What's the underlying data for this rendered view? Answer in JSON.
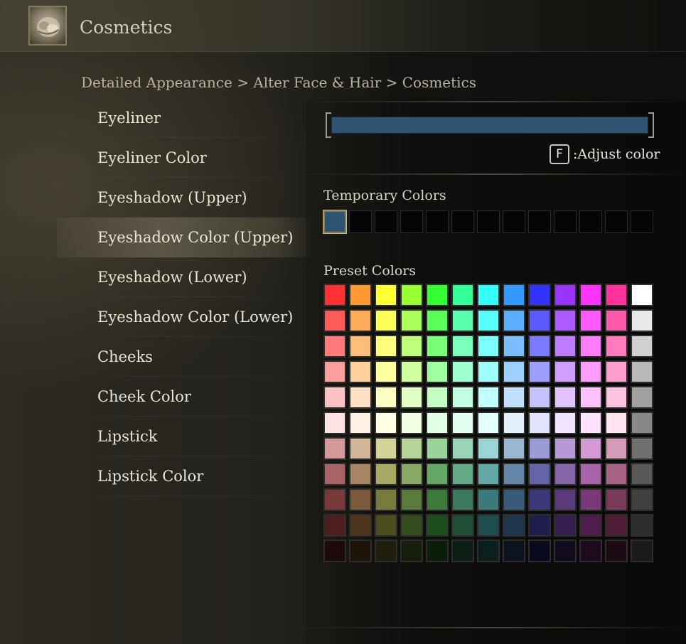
{
  "header": {
    "title": "Cosmetics",
    "icon": "face-makeup-icon"
  },
  "breadcrumb": "Detailed Appearance > Alter Face & Hair > Cosmetics",
  "menu": {
    "items": [
      {
        "label": "Eyeliner"
      },
      {
        "label": "Eyeliner Color"
      },
      {
        "label": "Eyeshadow (Upper)"
      },
      {
        "label": "Eyeshadow Color (Upper)",
        "selected": true
      },
      {
        "label": "Eyeshadow (Lower)"
      },
      {
        "label": "Eyeshadow Color (Lower)"
      },
      {
        "label": "Cheeks"
      },
      {
        "label": "Cheek Color"
      },
      {
        "label": "Lipstick"
      },
      {
        "label": "Lipstick Color"
      }
    ]
  },
  "color_panel": {
    "current_color": "#2f5471",
    "adjust_key": "F",
    "adjust_label": ":Adjust color",
    "temporary_label": "Temporary Colors",
    "temporary_colors": [
      "#2f5471",
      "#050505",
      "#050505",
      "#050505",
      "#050505",
      "#050505",
      "#050505",
      "#050505",
      "#050505",
      "#050505",
      "#050505",
      "#050505",
      "#050505"
    ],
    "preset_label": "Preset Colors",
    "preset_colors": [
      [
        "#ff3333",
        "#ff9933",
        "#ffff33",
        "#99ff33",
        "#33ff33",
        "#33ff99",
        "#33ffff",
        "#3399ff",
        "#3333ff",
        "#9933ff",
        "#ff33ff",
        "#ff3399",
        "#ffffff"
      ],
      [
        "#ff5a5a",
        "#ffad5a",
        "#ffff5a",
        "#adff5a",
        "#5aff5a",
        "#5affad",
        "#5affff",
        "#5aadff",
        "#5a5aff",
        "#ad5aff",
        "#ff5aff",
        "#ff5aad",
        "#e8e8e8"
      ],
      [
        "#ff7b7b",
        "#ffbd7b",
        "#ffff7b",
        "#bdff7b",
        "#7bff7b",
        "#7bffbd",
        "#7bffff",
        "#7bbdff",
        "#7b7bff",
        "#bd7bff",
        "#ff7bff",
        "#ff7bbd",
        "#d0d0d0"
      ],
      [
        "#ff9e9e",
        "#ffcf9e",
        "#ffff9e",
        "#cfff9e",
        "#9eff9e",
        "#9effcf",
        "#9effff",
        "#9ecfff",
        "#9e9eff",
        "#cf9eff",
        "#ff9eff",
        "#ff9ecf",
        "#b8b8b8"
      ],
      [
        "#ffc2c2",
        "#ffe0c2",
        "#ffffc2",
        "#e0ffc2",
        "#c2ffc2",
        "#c2ffe0",
        "#c2ffff",
        "#c2e0ff",
        "#c2c2ff",
        "#e0c2ff",
        "#ffc2ff",
        "#ffc2e0",
        "#a0a0a0"
      ],
      [
        "#ffe3e3",
        "#fff1e3",
        "#ffffe3",
        "#f1ffe3",
        "#e3ffe3",
        "#e3fff1",
        "#e3ffff",
        "#e3f1ff",
        "#e3e3ff",
        "#f1e3ff",
        "#ffe3ff",
        "#ffe3f1",
        "#888888"
      ],
      [
        "#d49a9a",
        "#d4b79a",
        "#d4d49a",
        "#b7d49a",
        "#9ad49a",
        "#9ad4b7",
        "#9ad4d4",
        "#9ab7d4",
        "#9a9ad4",
        "#b79ad4",
        "#d49ad4",
        "#d49ab7",
        "#707070"
      ],
      [
        "#a86464",
        "#a88664",
        "#a8a864",
        "#86a864",
        "#64a864",
        "#64a886",
        "#64a8a8",
        "#6486a8",
        "#6464a8",
        "#8664a8",
        "#a864a8",
        "#a86486",
        "#585858"
      ],
      [
        "#7a3a3a",
        "#7a5a3a",
        "#7a7a3a",
        "#5a7a3a",
        "#3a7a3a",
        "#3a7a5a",
        "#3a7a7a",
        "#3a5a7a",
        "#3a3a7a",
        "#5a3a7a",
        "#7a3a7a",
        "#7a3a5a",
        "#404040"
      ],
      [
        "#4d1e1e",
        "#4d351e",
        "#4d4d1e",
        "#354d1e",
        "#1e4d1e",
        "#1e4d35",
        "#1e4d4d",
        "#1e354d",
        "#1e1e4d",
        "#351e4d",
        "#4d1e4d",
        "#4d1e35",
        "#2e2e2e"
      ],
      [
        "#1e0a0a",
        "#1e140a",
        "#1e1e0a",
        "#141e0a",
        "#0a1e0a",
        "#0a1e14",
        "#0a1e1e",
        "#0a141e",
        "#0a0a1e",
        "#140a1e",
        "#1e0a1e",
        "#1e0a14",
        "#1a1a1a"
      ]
    ]
  }
}
